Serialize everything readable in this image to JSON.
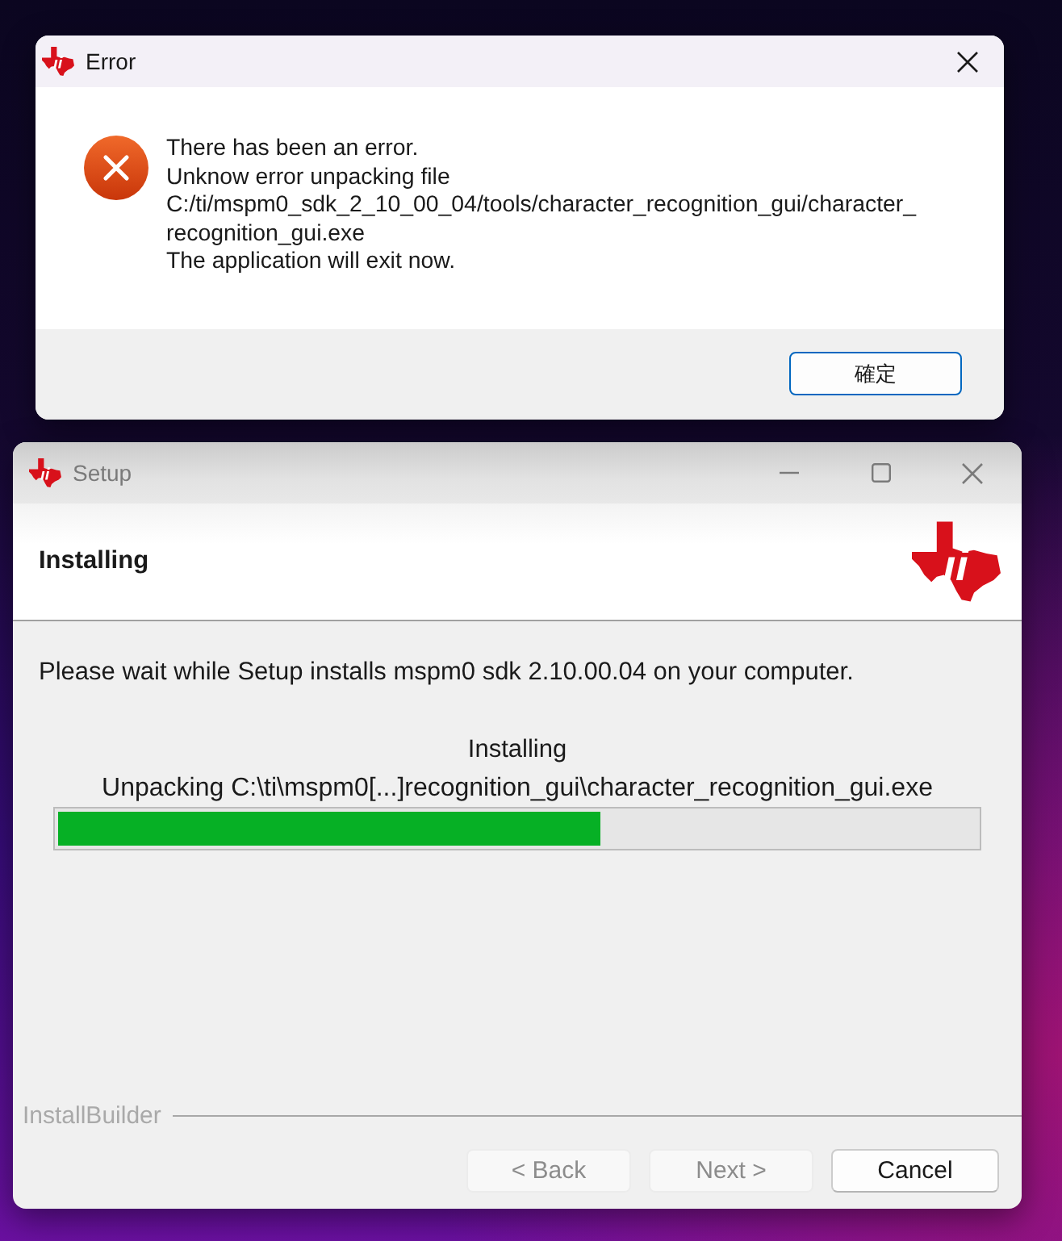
{
  "error_dialog": {
    "title": "Error",
    "active": true,
    "message_lines": [
      "There has been an error.",
      "Unknow error unpacking file",
      "C:/ti/mspm0_sdk_2_10_00_04/tools/character_recognition_gui/character_",
      "recognition_gui.exe",
      "The application will exit now."
    ],
    "buttons": [
      {
        "label": "確定",
        "default": true
      }
    ]
  },
  "setup_window": {
    "title": "Setup",
    "active": false,
    "page_title": "Installing",
    "intro": "Please wait while Setup installs mspm0 sdk 2.10.00.04 on your computer.",
    "status": "Installing",
    "detail": "Unpacking C:\\ti\\mspm0[...]recognition_gui\\character_recognition_gui.exe",
    "progress": {
      "level": 0.59
    },
    "branding": "InstallBuilder",
    "buttons": [
      {
        "label": "< Back",
        "disabled": true
      },
      {
        "label": "Next >",
        "disabled": true
      },
      {
        "label": "Cancel",
        "disabled": false
      }
    ]
  }
}
